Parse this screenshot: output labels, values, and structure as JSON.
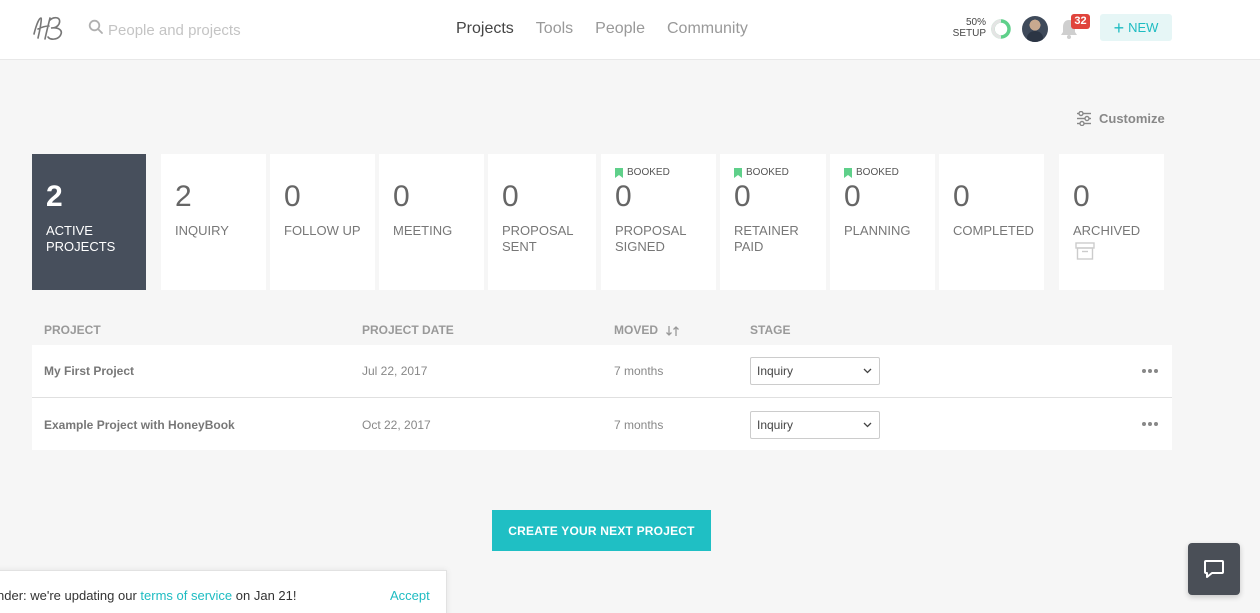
{
  "header": {
    "logo_text": "HB",
    "search_placeholder": "People and projects",
    "nav": [
      {
        "label": "Projects",
        "active": true
      },
      {
        "label": "Tools",
        "active": false
      },
      {
        "label": "People",
        "active": false
      },
      {
        "label": "Community",
        "active": false
      }
    ],
    "setup_percent": "50%",
    "setup_label": "SETUP",
    "setup_progress": 0.5,
    "notification_count": "32",
    "new_label": "NEW"
  },
  "customize_label": "Customize",
  "stages": [
    {
      "count": "2",
      "label": "ACTIVE\nPROJECTS",
      "active": true,
      "booked": false
    },
    {
      "count": "2",
      "label": "INQUIRY",
      "active": false,
      "booked": false
    },
    {
      "count": "0",
      "label": "FOLLOW UP",
      "active": false,
      "booked": false
    },
    {
      "count": "0",
      "label": "MEETING",
      "active": false,
      "booked": false
    },
    {
      "count": "0",
      "label": "PROPOSAL\nSENT",
      "active": false,
      "booked": false
    },
    {
      "count": "0",
      "label": "PROPOSAL\nSIGNED",
      "active": false,
      "booked": true
    },
    {
      "count": "0",
      "label": "RETAINER\nPAID",
      "active": false,
      "booked": true
    },
    {
      "count": "0",
      "label": "PLANNING",
      "active": false,
      "booked": true
    },
    {
      "count": "0",
      "label": "COMPLETED",
      "active": false,
      "booked": false
    },
    {
      "count": "0",
      "label": "ARCHIVED",
      "active": false,
      "booked": false,
      "archive": true
    }
  ],
  "booked_label": "BOOKED",
  "table": {
    "headers": {
      "project": "PROJECT",
      "date": "PROJECT DATE",
      "moved": "MOVED",
      "stage": "STAGE"
    },
    "rows": [
      {
        "name": "My First Project",
        "date": "Jul 22, 2017",
        "moved": "7 months",
        "stage": "Inquiry"
      },
      {
        "name": "Example Project with HoneyBook",
        "date": "Oct 22, 2017",
        "moved": "7 months",
        "stage": "Inquiry"
      }
    ]
  },
  "create_button": "CREATE YOUR NEXT PROJECT",
  "notice": {
    "prefix": "nder: we're updating our ",
    "link": "terms of service",
    "suffix": " on Jan 21!",
    "accept": "Accept"
  },
  "colors": {
    "accent": "#1ebcc2",
    "active_card": "#474f5c",
    "booked": "#5fd08a",
    "badge": "#e0443c"
  }
}
